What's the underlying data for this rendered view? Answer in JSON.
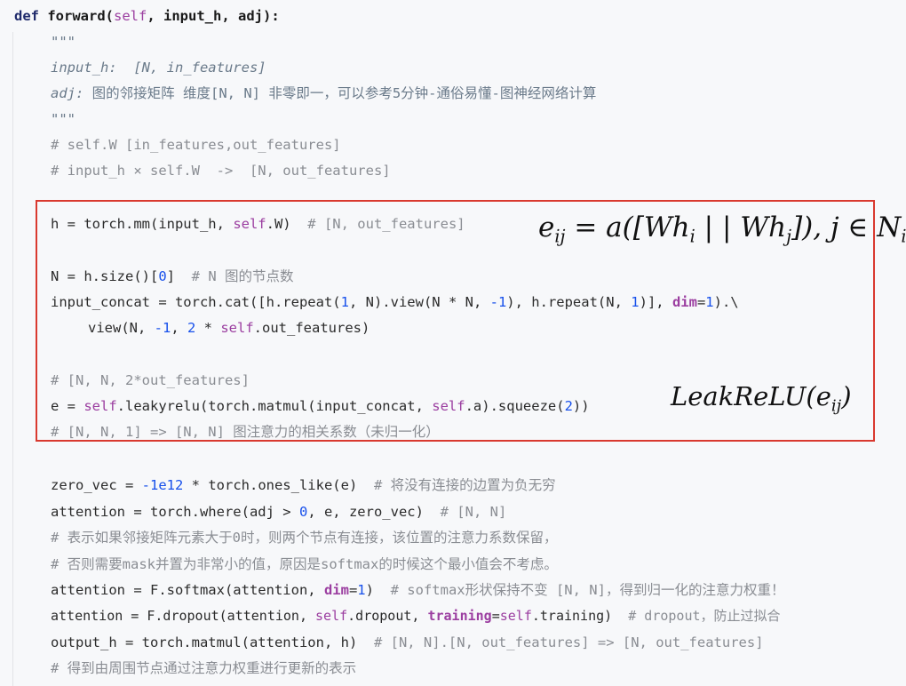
{
  "code": {
    "def_keyword": "def",
    "func_name": "forward",
    "signature_open": "(",
    "self_word": "self",
    "signature_rest": ", input_h, adj):",
    "docstring_open": "\"\"\"",
    "doc_input_h": "input_h:  [N, in_features]",
    "doc_adj_name": "adj: ",
    "doc_adj_desc": "图的邻接矩阵 维度[N, N] 非零即一，可以参考5分钟-通俗易懂-图神经网络计算",
    "docstring_close": "\"\"\"",
    "comment_w": "# self.W [in_features,out_features]",
    "comment_mul": "# input_h × self.W  ->  [N, out_features]",
    "h_line_a": "h = torch.mm(input_h, ",
    "h_line_self": "self",
    "h_line_b": ".W)",
    "h_line_cmt": "  # [N, out_features]",
    "n_line_a": "N = h.size()[",
    "n_line_num": "0",
    "n_line_b": "]",
    "n_line_cmt": "  # N 图的节点数",
    "concat_a": "input_concat = torch.cat([h.repeat(",
    "concat_1": "1",
    "concat_b": ", N).view(N * N, ",
    "concat_m1": "-1",
    "concat_c": "), h.repeat(N, ",
    "concat_1b": "1",
    "concat_d": ")], ",
    "concat_dim": "dim",
    "concat_e": "=",
    "concat_1c": "1",
    "concat_f": ").\\",
    "view_a": "view(N, ",
    "view_m1": "-1",
    "view_b": ", ",
    "view_2": "2",
    "view_c": " * ",
    "view_self": "self",
    "view_d": ".out_features)",
    "cmt_shape": "# [N, N, 2*out_features]",
    "e_a": "e = ",
    "e_self": "self",
    "e_b": ".leakyrelu(torch.matmul(input_concat, ",
    "e_self2": "self",
    "e_c": ".a).squeeze(",
    "e_2": "2",
    "e_d": "))",
    "cmt_corr": "# [N, N, 1] => [N, N] 图注意力的相关系数（未归一化）",
    "zero_a": "zero_vec = ",
    "zero_num": "-1e12",
    "zero_b": " * torch.ones_like(e)",
    "zero_cmt": "  # 将没有连接的边置为负无穷",
    "att1_a": "attention = torch.where(adj > ",
    "att1_0": "0",
    "att1_b": ", e, zero_vec)",
    "att1_cmt": "  # [N, N]",
    "cmt_keep": "# 表示如果邻接矩阵元素大于0时，则两个节点有连接，该位置的注意力系数保留，",
    "cmt_mask": "# 否则需要mask并置为非常小的值，原因是softmax的时候这个最小值会不考虑。",
    "att2_a": "attention = F.softmax(attention, ",
    "att2_dim": "dim",
    "att2_eq": "=",
    "att2_1": "1",
    "att2_b": ")",
    "att2_cmt": "  # softmax形状保持不变 [N, N]，得到归一化的注意力权重！",
    "att3_a": "attention = F.dropout(attention, ",
    "att3_self": "self",
    "att3_b": ".dropout, ",
    "att3_training": "training",
    "att3_eq": "=",
    "att3_self2": "self",
    "att3_c": ".training)",
    "att3_cmt": "  # dropout，防止过拟合",
    "out_a": "output_h = torch.matmul(attention, h)",
    "out_cmt": "  # [N, N].[N, out_features] => [N, out_features]",
    "cmt_final": "# 得到由周围节点通过注意力权重进行更新的表示"
  },
  "annotations": {
    "eq1_e": "e",
    "eq1_ij": "ij",
    "eq1_mid": " = a([Wh",
    "eq1_i": "i",
    "eq1_bars": " | | Wh",
    "eq1_j": "j",
    "eq1_tail": "]), j ∈ N",
    "eq1_Ni": "i",
    "eq2_a": "LeakReLU(e",
    "eq2_ij": "ij",
    "eq2_b": ")"
  }
}
